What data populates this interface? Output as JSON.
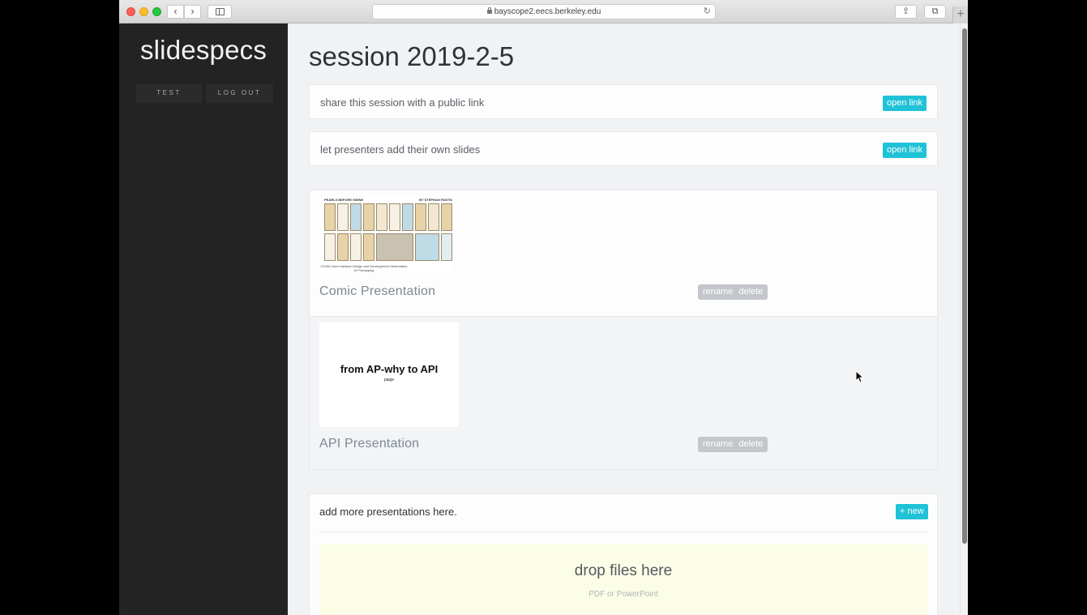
{
  "browser": {
    "url": "bayscope2.eecs.berkeley.edu",
    "nav_back_icon": "chevron-left-icon",
    "nav_forward_icon": "chevron-right-icon",
    "back_glyph": "‹",
    "forward_glyph": "›",
    "reload_glyph": "↻",
    "share_glyph": "⇪",
    "tabs_glyph": "⧉",
    "newtab_glyph": "+"
  },
  "sidebar": {
    "brand": "slidespecs",
    "test_label": "TEST",
    "logout_label": "LOG OUT"
  },
  "page": {
    "title": "session 2019-2-5"
  },
  "share_card": {
    "text": "share this session with a public link",
    "button": "open link"
  },
  "presenters_card": {
    "text": "let presenters add their own slides",
    "button": "open link"
  },
  "presentations": [
    {
      "name": "Comic Presentation",
      "rename": "rename",
      "delete": "delete",
      "thumb": {
        "head_left": "PEARLS BEFORE SWINE",
        "head_right": "BY STEPHAN PASTIS",
        "caption": "CS160 User Interface Design and Development Observation to Prototyping"
      }
    },
    {
      "name": "API Presentation",
      "rename": "rename",
      "delete": "delete",
      "thumb": {
        "title": "from AP-why to API",
        "subtitle": "paige"
      }
    }
  ],
  "add_section": {
    "text": "add more presentations here.",
    "new_button": "+ new",
    "drop_title": "drop files here",
    "drop_subtitle": "PDF or PowerPoint"
  },
  "colors": {
    "accent": "#1fc2d6",
    "sidebar_bg": "#232323",
    "dropzone_bg": "#fbfde6"
  }
}
